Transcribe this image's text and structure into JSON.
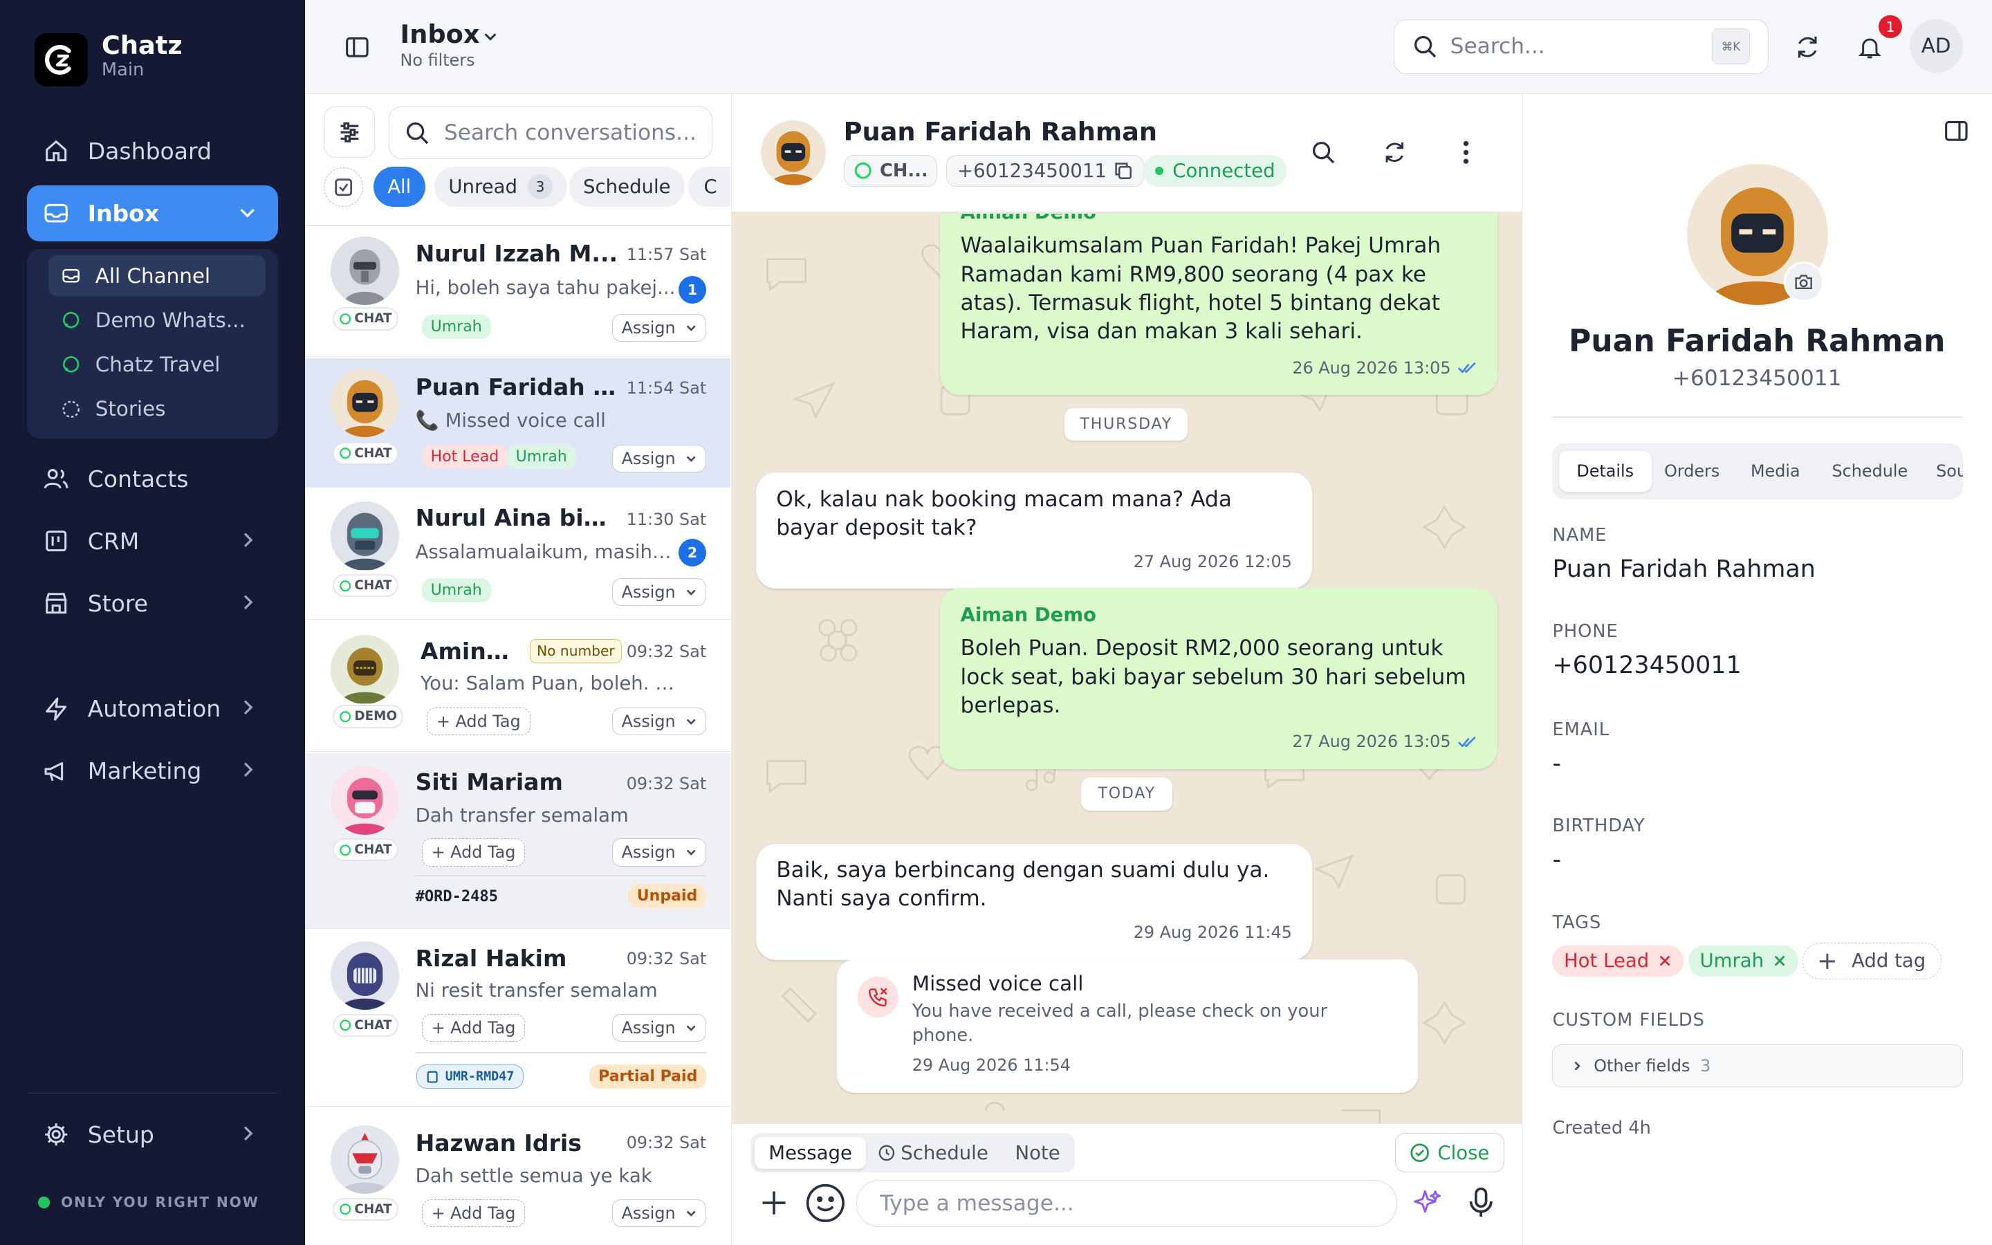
{
  "brand": {
    "name": "Chatz",
    "workspace": "Main"
  },
  "nav": {
    "dashboard": "Dashboard",
    "inbox": "Inbox",
    "contacts": "Contacts",
    "crm": "CRM",
    "store": "Store",
    "automation": "Automation",
    "marketing": "Marketing",
    "setup": "Setup",
    "inbox_sub": [
      "All Channel",
      "Demo Whats...",
      "Chatz Travel",
      "Stories"
    ]
  },
  "status": "ONLY YOU RIGHT NOW",
  "header": {
    "title": "Inbox",
    "subtitle": "No filters",
    "search_placeholder": "Search...",
    "kbd": "⌘K",
    "notif_count": "1",
    "user_initials": "AD"
  },
  "list": {
    "search_placeholder": "Search conversations...",
    "filters": [
      {
        "label": "All"
      },
      {
        "label": "Unread",
        "count": "3"
      },
      {
        "label": "Schedule"
      },
      {
        "label": "C"
      }
    ],
    "assign_label": "Assign",
    "add_tag_label": "+ Add Tag",
    "conversations": [
      {
        "name": "Nurul Izzah M...",
        "time": "11:57 Sat",
        "preview": "Hi, boleh saya tahu pakej...",
        "unread": "1",
        "channel": "CHAT",
        "tags": [
          "Umrah"
        ]
      },
      {
        "name": "Puan Faridah ...",
        "time": "11:54 Sat",
        "preview": "📞 Missed voice call",
        "channel": "CHAT",
        "tags": [
          "Hot Lead",
          "Umrah"
        ]
      },
      {
        "name": "Nurul Aina bin...",
        "time": "11:30 Sat",
        "preview": "Assalamualaikum, masih ...",
        "unread": "2",
        "channel": "CHAT",
        "tags": [
          "Umrah"
        ]
      },
      {
        "name": "Amina...",
        "badge": "No number",
        "time": "09:32 Sat",
        "preview": "You: Salam Puan, boleh. Say...",
        "channel": "DEMO"
      },
      {
        "name": "Siti Mariam",
        "time": "09:32 Sat",
        "preview": "Dah transfer semalam",
        "channel": "CHAT",
        "order": "#ORD-2485",
        "order_status": "Unpaid"
      },
      {
        "name": "Rizal Hakim",
        "time": "09:32 Sat",
        "preview": "Ni resit transfer semalam",
        "channel": "CHAT",
        "order": "UMR-RMD47",
        "order_status": "Partial Paid"
      },
      {
        "name": "Hazwan Idris",
        "time": "09:32 Sat",
        "preview": "Dah settle semua ye kak",
        "channel": "CHAT"
      }
    ]
  },
  "chat": {
    "contact_name": "Puan Faridah Rahman",
    "channel": "CH...",
    "phone": "+60123450011",
    "status": "Connected",
    "sender_top": "Aiman Demo",
    "messages": [
      {
        "dir": "out",
        "text": "Waalaikumsalam Puan Faridah! Pakej Umrah Ramadan kami RM9,800 seorang (4 pax ke atas). Termasuk flight, hotel 5 bintang dekat Haram, visa dan makan 3 kali sehari.",
        "time": "26 Aug 2026 13:05"
      },
      {
        "dir": "in",
        "text": "Ok, kalau nak booking macam mana? Ada bayar deposit tak?",
        "time": "27 Aug 2026 12:05"
      },
      {
        "dir": "out",
        "sender": "Aiman Demo",
        "text": "Boleh Puan. Deposit RM2,000 seorang untuk lock seat, baki bayar sebelum 30 hari sebelum berlepas.",
        "time": "27 Aug 2026 13:05"
      },
      {
        "dir": "in",
        "text": "Baik, saya berbincang dengan suami dulu ya. Nanti saya confirm.",
        "time": "29 Aug 2026 11:45"
      }
    ],
    "day_separators": [
      "THURSDAY",
      "TODAY"
    ],
    "call": {
      "title": "Missed voice call",
      "body": "You have received a call, please check on your phone.",
      "time": "29 Aug 2026 11:54"
    },
    "composer": {
      "tabs": [
        "Message",
        "Schedule",
        "Note"
      ],
      "close": "Close",
      "placeholder": "Type a message..."
    }
  },
  "profile": {
    "name": "Puan Faridah Rahman",
    "phone": "+60123450011",
    "tabs": [
      "Details",
      "Orders",
      "Media",
      "Schedule",
      "Sou"
    ],
    "labels": {
      "name": "NAME",
      "phone": "PHONE",
      "email": "EMAIL",
      "birthday": "BIRTHDAY",
      "tags": "TAGS",
      "custom": "CUSTOM FIELDS"
    },
    "email": "-",
    "birthday": "-",
    "tags": [
      "Hot Lead",
      "Umrah"
    ],
    "add_tag": "Add tag",
    "other_fields": "Other fields",
    "other_count": "3",
    "created": "Created 4h"
  },
  "colors": {
    "sidebar": "#141a33",
    "accent": "#3e8bf2",
    "chat_bg": "#efe6d7",
    "bubble_out": "#dcf9cc",
    "whatsapp": "#25d366"
  }
}
